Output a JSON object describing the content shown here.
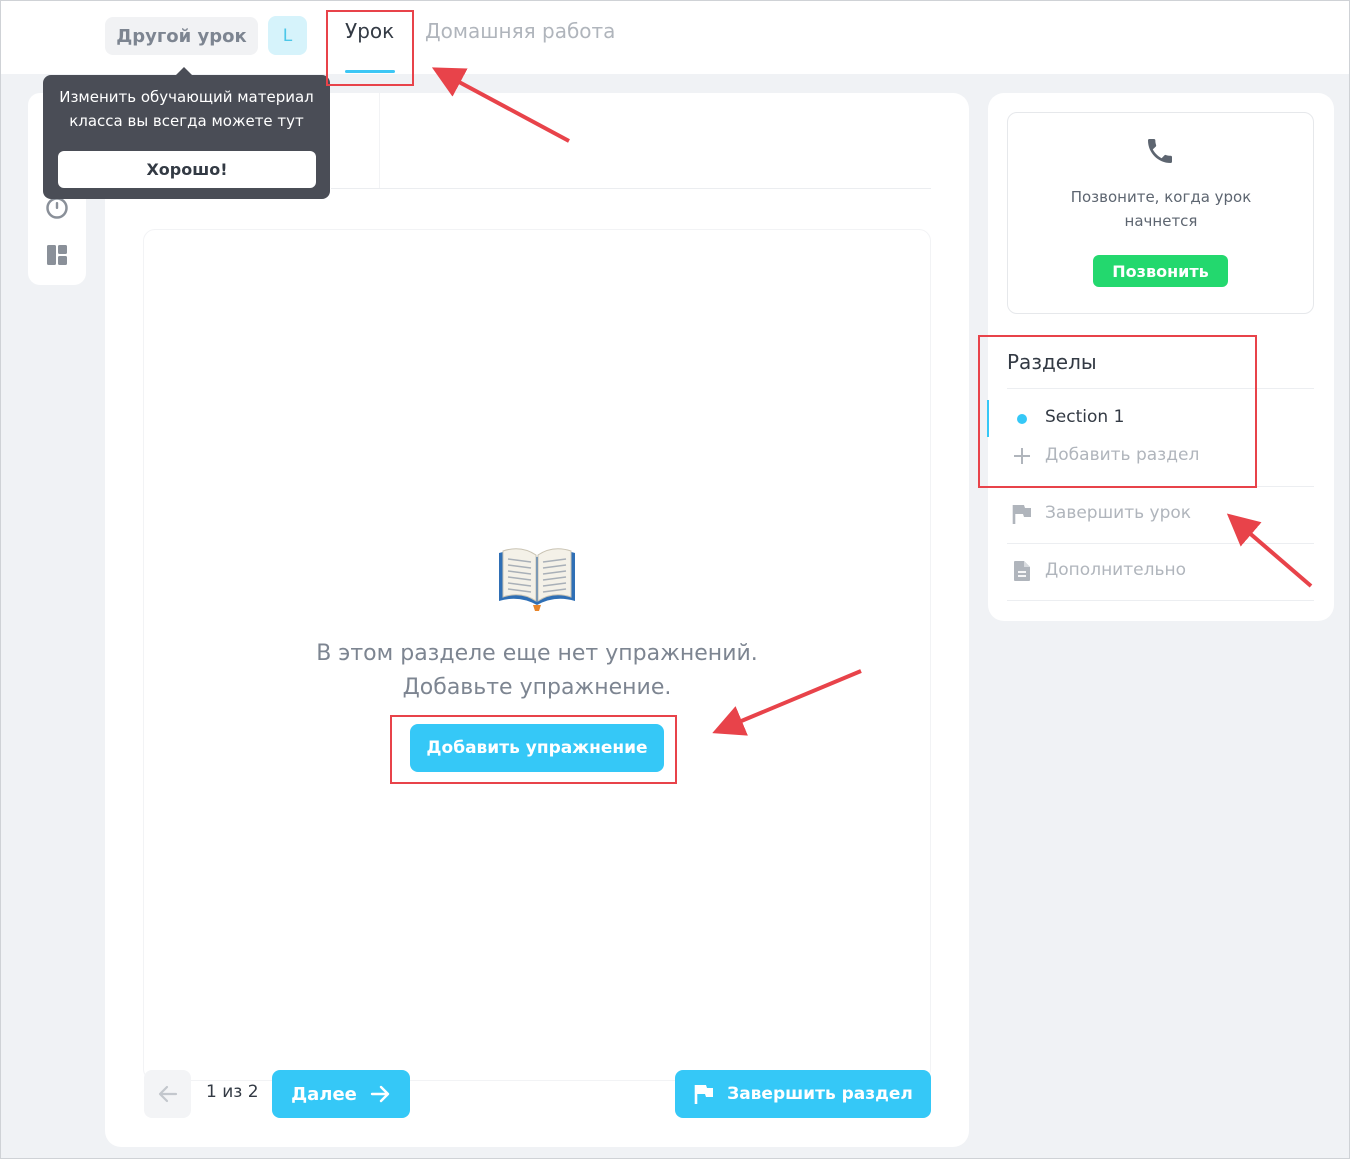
{
  "header": {
    "other_lesson_button": "Другой урок",
    "avatar_letter": "L",
    "tabs": [
      {
        "label": "Урок",
        "active": true
      },
      {
        "label": "Домашняя работа",
        "active": false
      }
    ]
  },
  "tooltip": {
    "text": "Изменить обучающий материал класса вы всегда можете тут",
    "confirm_button": "Хорошо!"
  },
  "main": {
    "empty_message_line1": "В этом разделе еще нет упражнений.",
    "empty_message_line2": "Добавьте упражнение.",
    "add_exercise_button": "Добавить упражнение",
    "pager": "1 из 2",
    "next_button": "Далее",
    "finish_section_button": "Завершить раздел"
  },
  "sidebar": {
    "call_text": "Позвоните, когда урок начнется",
    "call_button": "Позвонить",
    "sections_title": "Разделы",
    "sections": [
      {
        "label": "Section 1",
        "active": true
      }
    ],
    "add_section": "Добавить раздел",
    "finish_lesson": "Завершить урок",
    "additional": "Дополнительно"
  },
  "colors": {
    "accent": "#35c8f7",
    "call_green": "#23d86e",
    "highlight_red": "#e8434a",
    "tooltip_bg": "#4a4d56"
  }
}
